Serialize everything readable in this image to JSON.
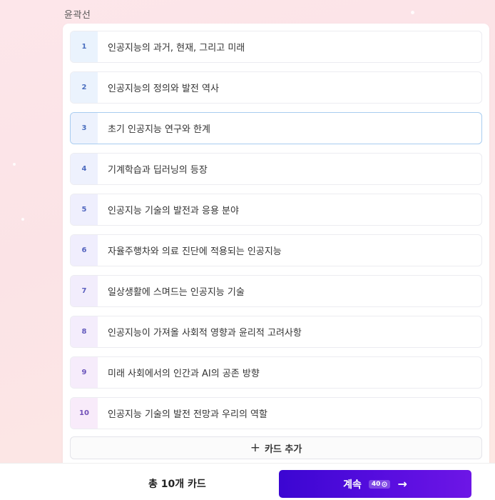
{
  "outline": {
    "title": "윤곽선",
    "items": [
      {
        "num": "1",
        "label": "인공지능의 과거, 현재, 그리고 미래",
        "num_bg": "#eaf3fd",
        "num_color": "#4b6fbf"
      },
      {
        "num": "2",
        "label": "인공지능의 정의와 발전 역사",
        "num_bg": "#ebf3fd",
        "num_color": "#4b6fbf"
      },
      {
        "num": "3",
        "label": "초기 인공지능 연구와 한계",
        "num_bg": "#edf2fd",
        "num_color": "#4b6fbf"
      },
      {
        "num": "4",
        "label": "기계학습과 딥러닝의 등장",
        "num_bg": "#eef1fd",
        "num_color": "#4d6bbf"
      },
      {
        "num": "5",
        "label": "인공지능 기술의 발전과 응용 분야",
        "num_bg": "#efeffd",
        "num_color": "#5167bf"
      },
      {
        "num": "6",
        "label": "자율주행차와 의료 진단에 적용되는 인공지능",
        "num_bg": "#f0eefd",
        "num_color": "#5564bf"
      },
      {
        "num": "7",
        "label": "일상생활에 스며드는 인공지능 기술",
        "num_bg": "#f2edfc",
        "num_color": "#5a5fbf"
      },
      {
        "num": "8",
        "label": "인공지능이 가져올 사회적 영향과 윤리적 고려사항",
        "num_bg": "#f4edfc",
        "num_color": "#625abd"
      },
      {
        "num": "9",
        "label": "미래 사회에서의 인간과 AI의 공존 방향",
        "num_bg": "#f6ecfb",
        "num_color": "#6a55bb"
      },
      {
        "num": "10",
        "label": "인공지능 기술의 발전 전망과 우리의 역할",
        "num_bg": "#f8ebfa",
        "num_color": "#7150b8"
      }
    ],
    "active_index": 2,
    "add_card_label": "카드 추가"
  },
  "footer": {
    "total_label": "총 10개 카드",
    "continue_label": "계속",
    "credit_cost": "40",
    "accent": "#4b0ad8"
  }
}
